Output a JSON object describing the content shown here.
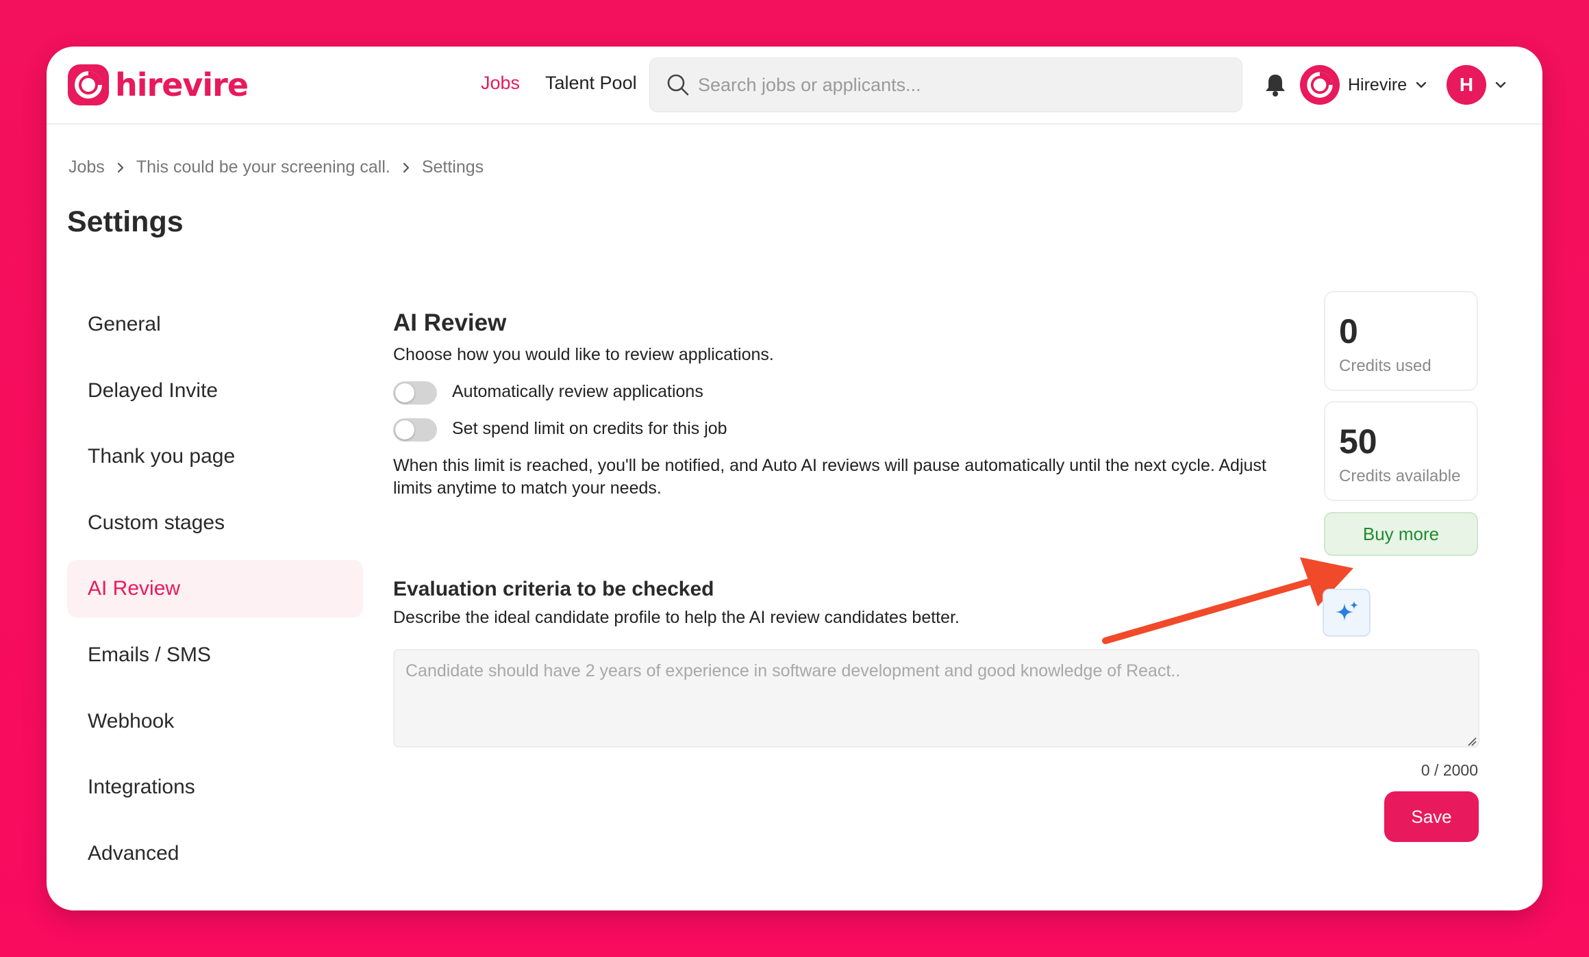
{
  "brand": {
    "name": "hirevire",
    "accent": "#e8195c",
    "background": "#f50d5b"
  },
  "nav": {
    "jobs": "Jobs",
    "talent_pool": "Talent Pool"
  },
  "search": {
    "placeholder": "Search jobs or applicants...",
    "value": ""
  },
  "icons": {
    "search": "search-icon",
    "bell": "bell-icon",
    "chevron": "chevron-down-icon",
    "sparkle": "sparkle-icon",
    "arrow": "annotation-arrow"
  },
  "org": {
    "name": "Hirevire"
  },
  "user": {
    "initial": "H"
  },
  "breadcrumb": [
    "Jobs",
    "This could be your screening call.",
    "Settings"
  ],
  "page": {
    "title": "Settings"
  },
  "sidebar": {
    "items": [
      {
        "label": "General"
      },
      {
        "label": "Delayed Invite"
      },
      {
        "label": "Thank you page"
      },
      {
        "label": "Custom stages"
      },
      {
        "label": "AI Review",
        "active": true
      },
      {
        "label": "Emails / SMS"
      },
      {
        "label": "Webhook"
      },
      {
        "label": "Integrations"
      },
      {
        "label": "Advanced"
      }
    ]
  },
  "ai_review": {
    "title": "AI Review",
    "subtitle": "Choose how you would like to review applications.",
    "toggle_auto": {
      "label": "Automatically review applications",
      "on": false
    },
    "toggle_limit": {
      "label": "Set spend limit on credits for this job",
      "on": false
    },
    "limit_note_line1": "When this limit is reached, you'll be notified, and Auto AI reviews will pause automatically until the next cycle. Adjust",
    "limit_note_line2": "limits anytime to match your needs."
  },
  "credits": {
    "used_value": "0",
    "used_label": "Credits used",
    "available_value": "50",
    "available_label": "Credits available",
    "buy_label": "Buy more"
  },
  "criteria": {
    "title": "Evaluation criteria to be checked",
    "subtitle": "Describe the ideal candidate profile to help the AI review candidates better.",
    "placeholder": "Candidate should have 2 years of experience in software development and good knowledge of React..",
    "value": "",
    "counter": "0 / 2000",
    "save_label": "Save"
  }
}
